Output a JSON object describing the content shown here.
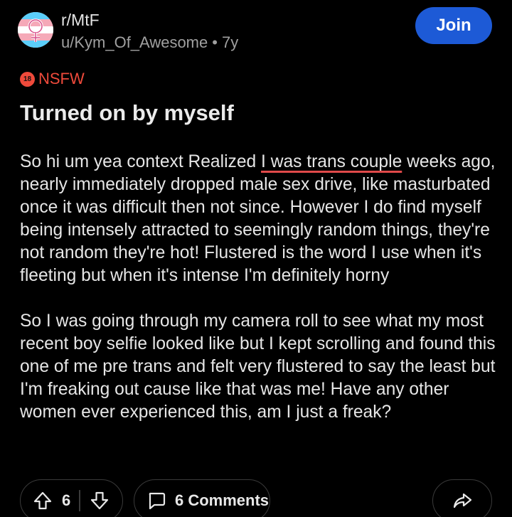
{
  "post": {
    "subreddit": "r/MtF",
    "author": "u/Kym_Of_Awesome",
    "separator": "•",
    "age": "7y",
    "join_label": "Join",
    "nsfw_badge": "18",
    "nsfw_label": "NSFW",
    "title": "Turned on by myself",
    "body": {
      "p1_before": "So hi um yea context Realized ",
      "p1_underlined": "I was trans couple",
      "p1_after": " weeks ago, nearly immediately dropped male sex drive, like masturbated once it was difficult then not since. However I do find myself being intensely attracted to seemingly random things, they're not random they're hot! Flustered is the word I use when it's fleeting but when it's intense I'm definitely horny",
      "p2": "So I was going through my camera roll to see what my most recent boy selfie looked like but I kept scrolling and found this one of me pre trans and felt very flustered to say the least but I'm freaking out cause like that was me! Have any other women ever experienced this, am I just a freak?"
    }
  },
  "actions": {
    "upvotes": "6",
    "comments_label": "6 Comments"
  },
  "colors": {
    "background": "#000000",
    "join_button": "#1d5ad6",
    "nsfw": "#ef4a3b",
    "underline": "#e04a4a",
    "flag_blue": "#5bcefa",
    "flag_pink": "#f5a9b8",
    "flag_white": "#ffffff"
  },
  "icons": {
    "avatar": "trans-flag-venus-avatar",
    "upvote": "arrow-up-icon",
    "downvote": "arrow-down-icon",
    "comment": "comment-bubble-icon",
    "share": "share-arrow-icon"
  }
}
